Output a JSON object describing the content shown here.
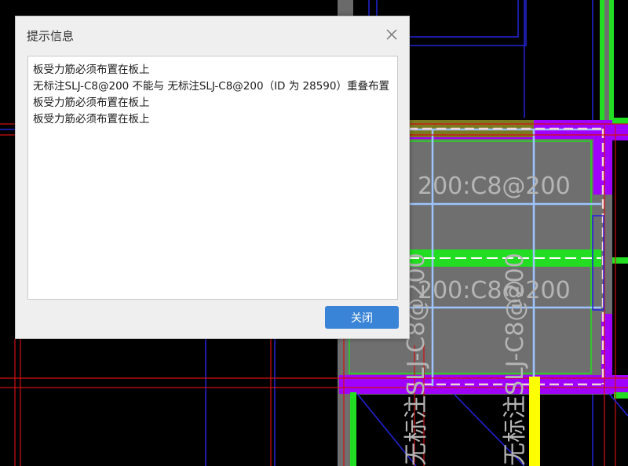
{
  "dialog": {
    "title": "提示信息",
    "messages": [
      "板受力筋必须布置在板上",
      "无标注SLJ-C8@200 不能与 无标注SLJ-C8@200（ID 为 28590）重叠布置",
      "板受力筋必须布置在板上",
      "板受力筋必须布置在板上"
    ],
    "close_button_label": "关闭",
    "close_icon": "close-icon"
  },
  "cad": {
    "annotations": {
      "rebar_upper": "200:C8@200",
      "rebar_lower": "200:C8@200",
      "vertical_left": "无标注SLJ-C8@200",
      "vertical_right": "无标注SLJ-C8@200"
    },
    "colors": {
      "background": "#000000",
      "slab": "#6f6f6f",
      "wall_purple": "#a000ff",
      "beam_green": "#22dd22",
      "axis_red": "#d01010",
      "edge_blue": "#2020e0",
      "rebar_lightblue": "#9ec4ff",
      "highlight_yellow": "#ffff00",
      "dashed_white": "#ffffff"
    }
  }
}
